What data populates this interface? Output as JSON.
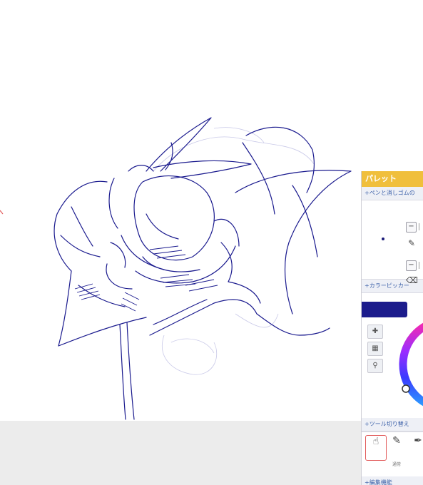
{
  "palette": {
    "title": "パレット",
    "pen_eraser_section": "+ペンと消しゴムの",
    "minus_label": "−",
    "color_picker_section": "+カラーピッカー",
    "tool_switch_section": "+ツール切り替え",
    "edit_section": "+編集機能",
    "tools": [
      {
        "icon": "hand-icon",
        "label": ""
      },
      {
        "icon": "pen-icon",
        "label": "通常"
      },
      {
        "icon": "brush-icon",
        "label": ""
      }
    ],
    "current_color": "#1c1c8c"
  },
  "colors": {
    "stroke": "#1a1a8e",
    "faint_stroke": "#c7c7e6",
    "header": "#f0bf3c",
    "bottom_bar": "#ececec",
    "active_tool_border": "#e25c5c"
  }
}
